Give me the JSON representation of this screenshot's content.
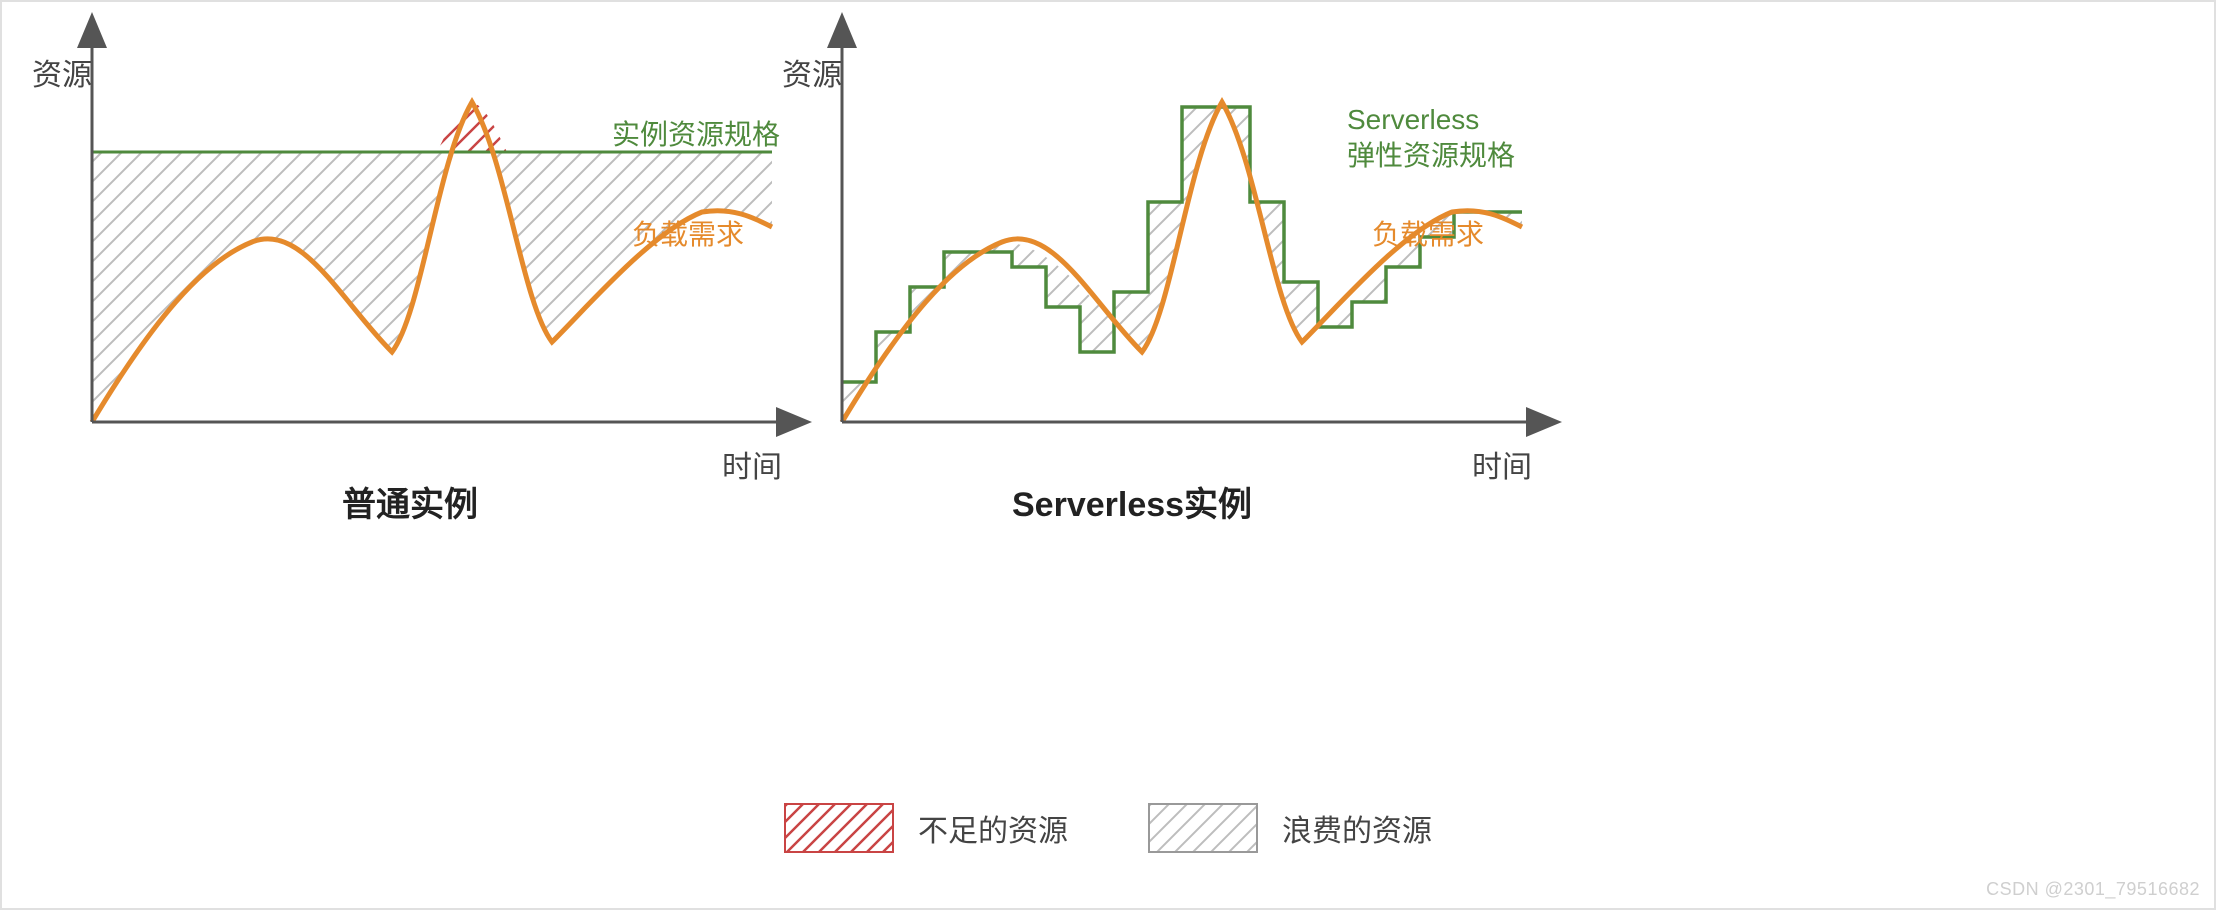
{
  "chart_data": [
    {
      "type": "line",
      "title": "普通实例",
      "xlabel": "时间",
      "ylabel": "资源",
      "series": [
        {
          "name": "实例资源规格",
          "kind": "constant",
          "value": 60,
          "color": "#4f8a3d"
        },
        {
          "name": "负载需求",
          "kind": "curve",
          "color": "#e58a2c",
          "x": [
            0,
            10,
            20,
            30,
            40,
            50,
            55,
            60,
            70,
            80,
            90,
            100
          ],
          "y": [
            0,
            25,
            45,
            38,
            20,
            50,
            90,
            50,
            30,
            50,
            60,
            55
          ]
        }
      ],
      "regions": [
        {
          "name": "浪费的资源",
          "definition": "area where 实例资源规格 > 负载需求",
          "hatch_color": "#999"
        },
        {
          "name": "不足的资源",
          "definition": "area where 负载需求 > 实例资源规格",
          "hatch_color": "#c94444"
        }
      ],
      "ylim": [
        0,
        100
      ],
      "xlim": [
        0,
        100
      ]
    },
    {
      "type": "line",
      "title": "Serverless实例",
      "xlabel": "时间",
      "ylabel": "资源",
      "series": [
        {
          "name": "Serverless\n弹性资源规格",
          "kind": "step",
          "color": "#4f8a3d",
          "x": [
            0,
            5,
            10,
            15,
            20,
            25,
            30,
            35,
            40,
            45,
            50,
            55,
            60,
            65,
            70,
            75,
            80,
            85,
            90,
            95,
            100
          ],
          "y_step": [
            12,
            28,
            42,
            48,
            48,
            42,
            28,
            22,
            40,
            70,
            92,
            92,
            70,
            45,
            34,
            40,
            50,
            58,
            62,
            62,
            62
          ]
        },
        {
          "name": "负载需求",
          "kind": "curve",
          "color": "#e58a2c",
          "x": [
            0,
            10,
            20,
            30,
            40,
            50,
            55,
            60,
            70,
            80,
            90,
            100
          ],
          "y": [
            0,
            25,
            45,
            38,
            20,
            50,
            90,
            50,
            30,
            50,
            60,
            55
          ]
        }
      ],
      "regions": [
        {
          "name": "浪费的资源",
          "definition": "area where 弹性资源规格 > 负载需求",
          "hatch_color": "#999"
        }
      ],
      "ylim": [
        0,
        100
      ],
      "xlim": [
        0,
        100
      ]
    }
  ],
  "labels": {
    "left": {
      "y_axis": "资源",
      "x_axis": "时间",
      "title": "普通实例",
      "resource_line": "实例资源规格",
      "demand_line": "负载需求"
    },
    "right": {
      "y_axis": "资源",
      "x_axis": "时间",
      "title": "Serverless实例",
      "resource_line": "Serverless\n弹性资源规格",
      "demand_line": "负载需求"
    }
  },
  "legend": {
    "insufficient": "不足的资源",
    "wasted": "浪费的资源"
  },
  "watermark": "CSDN @2301_79516682"
}
